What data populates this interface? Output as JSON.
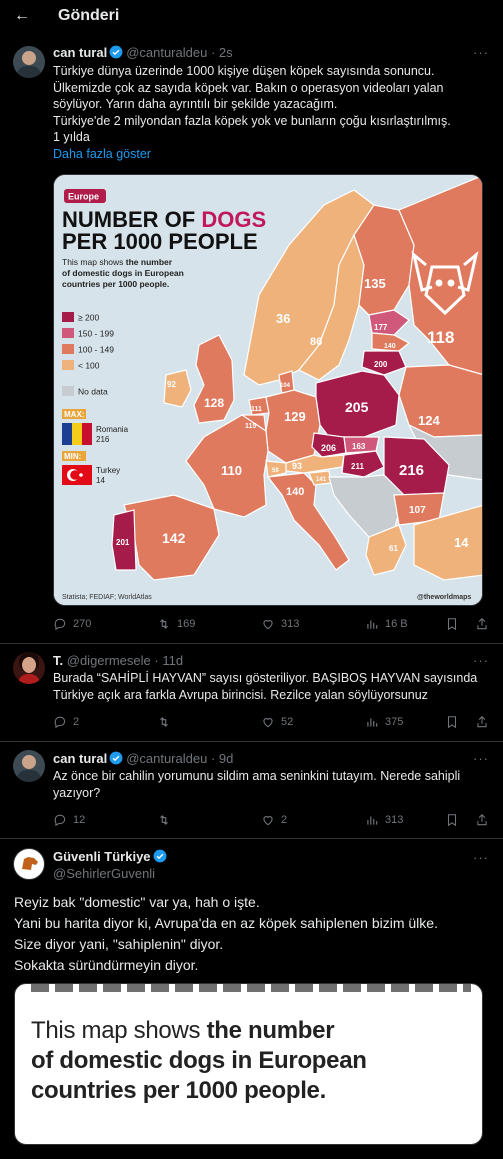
{
  "header": {
    "title": "Gönderi"
  },
  "tweets": [
    {
      "name": "can tural",
      "handle": "@canturaldeu",
      "time": "2s",
      "lines": [
        "Türkiye dünya üzerinde 1000 kişiye düşen köpek sayısında sonuncu.",
        "Ülkemizde çok az sayıda köpek var. Bakın o operasyon videoları yalan",
        "söylüyor. Yarın daha ayrıntılı bir şekilde yazacağım.",
        "Türkiye'de 2 milyondan fazla köpek yok ve bunların çoğu kısırlaştırılmış.",
        "1 yılda"
      ],
      "show_more": "Daha fazla göster",
      "stats": {
        "replies": "270",
        "reposts": "169",
        "likes": "313",
        "views": "16 B"
      }
    },
    {
      "name": "T.",
      "handle": "@digermesele",
      "time": "11d",
      "lines": [
        "Burada “SAHİPLİ HAYVAN” sayısı gösteriliyor. BAŞIBOŞ HAYVAN sayısında",
        "Türkiye açık ara farkla Avrupa birincisi. Rezilce yalan söylüyorsunuz"
      ],
      "stats": {
        "replies": "2",
        "reposts": "",
        "likes": "52",
        "views": "375"
      }
    },
    {
      "name": "can tural",
      "handle": "@canturaldeu",
      "time": "9d",
      "lines": [
        "Az önce bir cahilin yorumunu sildim ama seninkini tutayım. Nerede sahipli",
        "yazıyor?"
      ],
      "stats": {
        "replies": "12",
        "reposts": "",
        "likes": "2",
        "views": "313"
      }
    },
    {
      "name": "Güvenli Türkiye",
      "handle": "@SehirlerGuvenli",
      "lines": [
        "Reyiz bak \"domestic\" var ya, hah o işte.",
        "Yani bu harita diyor ki, Avrupa'da en az köpek sahiplenen bizim ülke.",
        "Size diyor yani, \"sahiplenin\" diyor.",
        "Sokakta süründürmeyin diyor."
      ]
    }
  ],
  "map": {
    "badge": "Europe",
    "title_1": "NUMBER OF ",
    "title_1_accent": "DOGS",
    "title_2": "PER 1000 PEOPLE",
    "desc_1": "This map shows ",
    "desc_1_bold": "the number",
    "desc_2": "of domestic dogs in European",
    "desc_3": "countries per 1000 people.",
    "legend": [
      {
        "label": "≥ 200",
        "color": "#a51c4b"
      },
      {
        "label": "150 - 199",
        "color": "#d0587a"
      },
      {
        "label": "100 - 149",
        "color": "#e07a5f"
      },
      {
        "label": "< 100",
        "color": "#efb27a"
      }
    ],
    "nodata": "No data",
    "max_label": "MAX:",
    "max_country": "Romania",
    "max_value": "216",
    "min_label": "MIN:",
    "min_country": "Turkey",
    "min_value": "14",
    "source": "Statista; FEDIAF; WorldAtlas",
    "credit": "@theworldmaps",
    "values": {
      "norway": "36",
      "sweden": "86",
      "finland": "135",
      "russia": "118",
      "estonia": "177",
      "latvia": "140",
      "lithuania": "200",
      "denmark": "104",
      "ireland": "92",
      "uk": "128",
      "netherlands": "111",
      "belgium": "115",
      "germany": "129",
      "poland": "205",
      "belarus": "124",
      "czechia": "206",
      "slovakia": "163",
      "hungary": "211",
      "romania": "216",
      "france": "110",
      "switzerland": "59",
      "austria": "93",
      "slovenia": "141",
      "italy": "140",
      "bulgaria": "107",
      "greece": "61",
      "turkey": "14",
      "spain": "142",
      "portugal": "201"
    }
  },
  "image_card": {
    "line1": "This map shows ",
    "line1_bold": "the number",
    "line2": "of domestic dogs in European",
    "line3": "countries per 1000 people."
  }
}
